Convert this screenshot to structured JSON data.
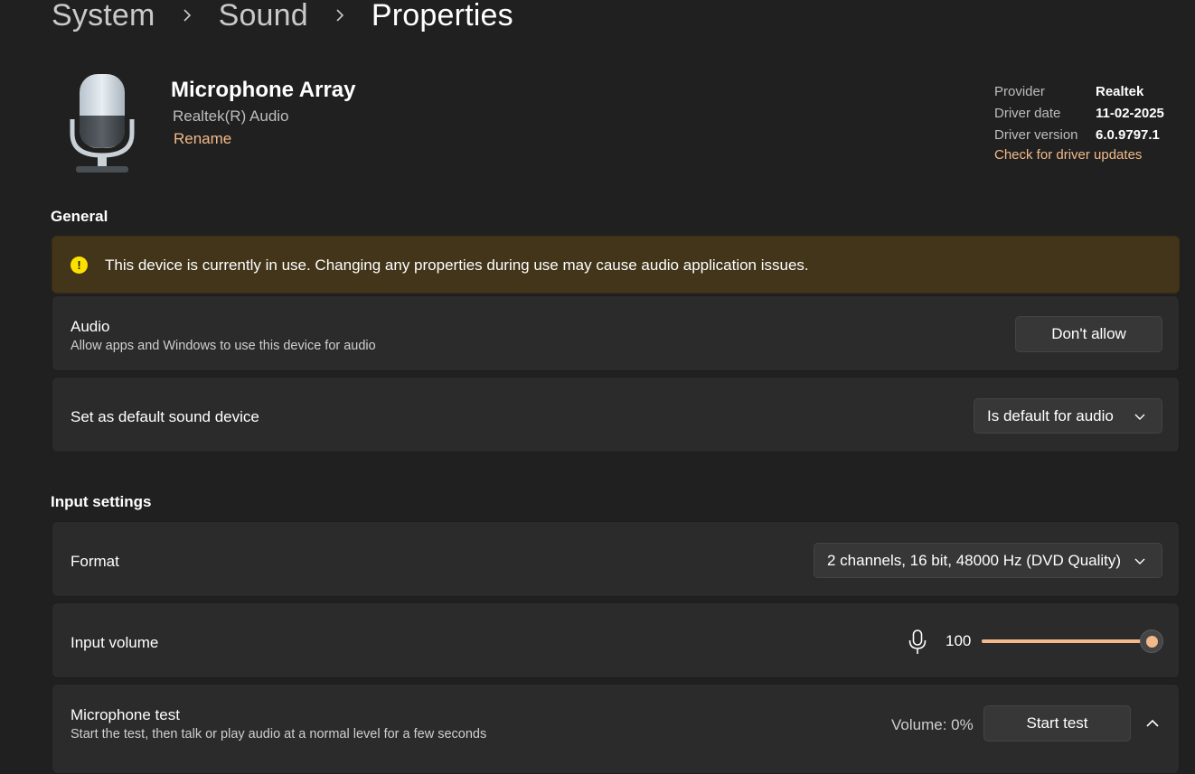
{
  "breadcrumb": {
    "items": [
      "System",
      "Sound",
      "Properties"
    ]
  },
  "device": {
    "name": "Microphone Array",
    "subtitle": "Realtek(R) Audio",
    "rename_label": "Rename",
    "icon": "microphone-icon"
  },
  "driver": {
    "provider_label": "Provider",
    "provider_value": "Realtek",
    "date_label": "Driver date",
    "date_value": "11-02-2025",
    "version_label": "Driver version",
    "version_value": "6.0.9797.1",
    "updates_link": "Check for driver updates"
  },
  "general": {
    "title": "General",
    "warning_text": "This device is currently in use. Changing any properties during use may cause audio application issues.",
    "audio_title": "Audio",
    "audio_desc": "Allow apps and Windows to use this device for audio",
    "audio_button": "Don't allow",
    "default_title": "Set as default sound device",
    "default_value": "Is default for audio"
  },
  "input": {
    "title": "Input settings",
    "format_label": "Format",
    "format_value": "2 channels, 16 bit, 48000 Hz (DVD Quality)",
    "volume_label": "Input volume",
    "volume_value": "100",
    "volume_fraction": 1.0,
    "mic_test_title": "Microphone test",
    "mic_test_desc": "Start the test, then talk or play audio at a normal level for a few seconds",
    "mic_test_volume": "Volume: 0%",
    "start_test_button": "Start test"
  },
  "colors": {
    "accent": "#f2b98a",
    "background": "#202020",
    "card": "#2b2b2b",
    "warning_bg": "#433519",
    "warning_icon": "#fce100"
  }
}
